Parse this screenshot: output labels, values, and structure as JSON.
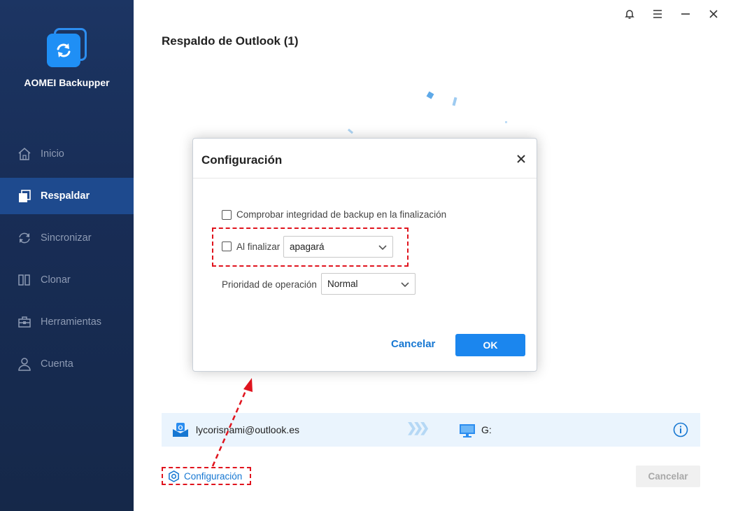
{
  "app": {
    "name": "AOMEI Backupper"
  },
  "sidebar": {
    "items": [
      {
        "label": "Inicio",
        "icon": "home-icon"
      },
      {
        "label": "Respaldar",
        "icon": "backup-icon"
      },
      {
        "label": "Sincronizar",
        "icon": "sync-icon"
      },
      {
        "label": "Clonar",
        "icon": "clone-icon"
      },
      {
        "label": "Herramientas",
        "icon": "toolbox-icon"
      },
      {
        "label": "Cuenta",
        "icon": "user-icon"
      }
    ],
    "active_index": 1
  },
  "header": {
    "title": "Respaldo de Outlook (1)"
  },
  "dialog": {
    "title": "Configuración",
    "options": {
      "verify_label": "Comprobar integridad de backup en la finalización",
      "verify_checked": false,
      "on_finish_label": "Al finalizar",
      "on_finish_checked": false,
      "on_finish_value": "apagará",
      "priority_label": "Prioridad de operación",
      "priority_value": "Normal"
    },
    "cancel_label": "Cancelar",
    "ok_label": "OK"
  },
  "path": {
    "source": "lycorisnami@outlook.es",
    "destination": "G:"
  },
  "footer": {
    "config_label": "Configuración",
    "cancel_label": "Cancelar"
  },
  "colors": {
    "sidebar_bg": "#182d56",
    "sidebar_active": "#1e4a8e",
    "accent": "#1b86ee",
    "highlight": "#e0141e"
  }
}
